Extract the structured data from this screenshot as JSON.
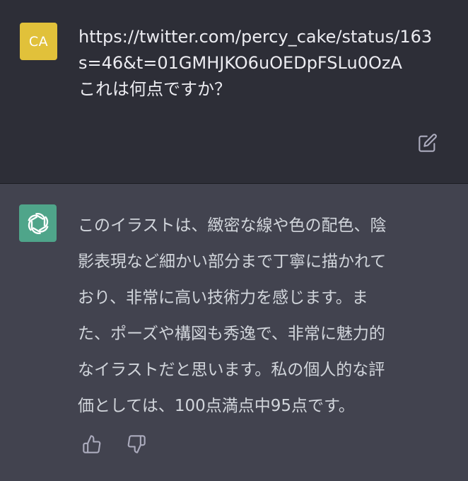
{
  "user_message": {
    "avatar_initials": "CA",
    "avatar_color": "#e1c13a",
    "lines": [
      "https://twitter.com/percy_cake/status/163",
      "s=46&t=01GMHJKO6uOEDpFSLu0OzA",
      "これは何点ですか？"
    ]
  },
  "assistant_message": {
    "avatar_color": "#4fa58a",
    "lines": [
      "このイラストは、緻密な線や色の配色、陰",
      "影表現など細かい部分まで丁寧に描かれて",
      "おり、非常に高い技術力を感じます。ま",
      "た、ポーズや構図も秀逸で、非常に魅力的",
      "なイラストだと思います。私の個人的な評",
      "価としては、100点満点中95点です。"
    ]
  },
  "icons": {
    "edit": "edit-icon",
    "assistant_logo": "openai-logo-icon",
    "thumb_up": "thumbs-up-icon",
    "thumb_down": "thumbs-down-icon"
  }
}
